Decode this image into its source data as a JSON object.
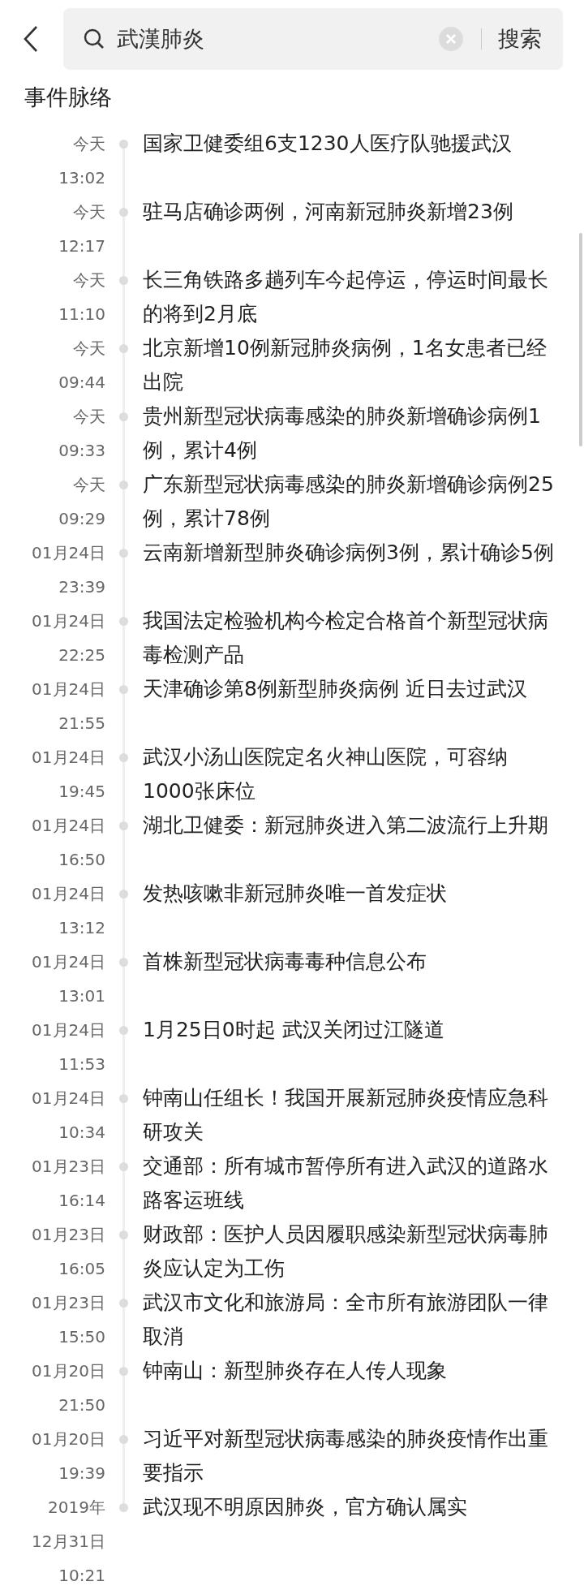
{
  "search": {
    "value": "武漢肺炎",
    "button": "搜索"
  },
  "section_title": "事件脉络",
  "events": [
    {
      "date": [
        "今天",
        "13:02"
      ],
      "title": "国家卫健委组6支1230人医疗队驰援武汉"
    },
    {
      "date": [
        "今天",
        "12:17"
      ],
      "title": "驻马店确诊两例，河南新冠肺炎新增23例"
    },
    {
      "date": [
        "今天",
        "11:10"
      ],
      "title": "长三角铁路多趟列车今起停运，停运时间最长的将到2月底"
    },
    {
      "date": [
        "今天",
        "09:44"
      ],
      "title": "北京新增10例新冠肺炎病例，1名女患者已经出院"
    },
    {
      "date": [
        "今天",
        "09:33"
      ],
      "title": "贵州新型冠状病毒感染的肺炎新增确诊病例1例，累计4例"
    },
    {
      "date": [
        "今天",
        "09:29"
      ],
      "title": "广东新型冠状病毒感染的肺炎新增确诊病例25例，累计78例"
    },
    {
      "date": [
        "01月24日",
        "23:39"
      ],
      "title": "云南新增新型肺炎确诊病例3例，累计确诊5例"
    },
    {
      "date": [
        "01月24日",
        "22:25"
      ],
      "title": "我国法定检验机构今检定合格首个新型冠状病毒检测产品"
    },
    {
      "date": [
        "01月24日",
        "21:55"
      ],
      "title": "天津确诊第8例新型肺炎病例 近日去过武汉"
    },
    {
      "date": [
        "01月24日",
        "19:45"
      ],
      "title": "武汉小汤山医院定名火神山医院，可容纳1000张床位"
    },
    {
      "date": [
        "01月24日",
        "16:50"
      ],
      "title": "湖北卫健委：新冠肺炎进入第二波流行上升期"
    },
    {
      "date": [
        "01月24日",
        "13:12"
      ],
      "title": "发热咳嗽非新冠肺炎唯一首发症状"
    },
    {
      "date": [
        "01月24日",
        "13:01"
      ],
      "title": "首株新型冠状病毒毒种信息公布"
    },
    {
      "date": [
        "01月24日",
        "11:53"
      ],
      "title": "1月25日0时起 武汉关闭过江隧道"
    },
    {
      "date": [
        "01月24日",
        "10:34"
      ],
      "title": "钟南山任组长！我国开展新冠肺炎疫情应急科研攻关"
    },
    {
      "date": [
        "01月23日",
        "16:14"
      ],
      "title": "交通部：所有城市暂停所有进入武汉的道路水路客运班线"
    },
    {
      "date": [
        "01月23日",
        "16:05"
      ],
      "title": "财政部：医护人员因履职感染新型冠状病毒肺炎应认定为工伤"
    },
    {
      "date": [
        "01月23日",
        "15:50"
      ],
      "title": "武汉市文化和旅游局：全市所有旅游团队一律取消"
    },
    {
      "date": [
        "01月20日",
        "21:50"
      ],
      "title": "钟南山：新型肺炎存在人传人现象"
    },
    {
      "date": [
        "01月20日",
        "19:39"
      ],
      "title": "习近平对新型冠状病毒感染的肺炎疫情作出重要指示"
    },
    {
      "date": [
        "2019年",
        "12月31日",
        "10:21"
      ],
      "title": "武汉现不明原因肺炎，官方确认属实"
    }
  ]
}
